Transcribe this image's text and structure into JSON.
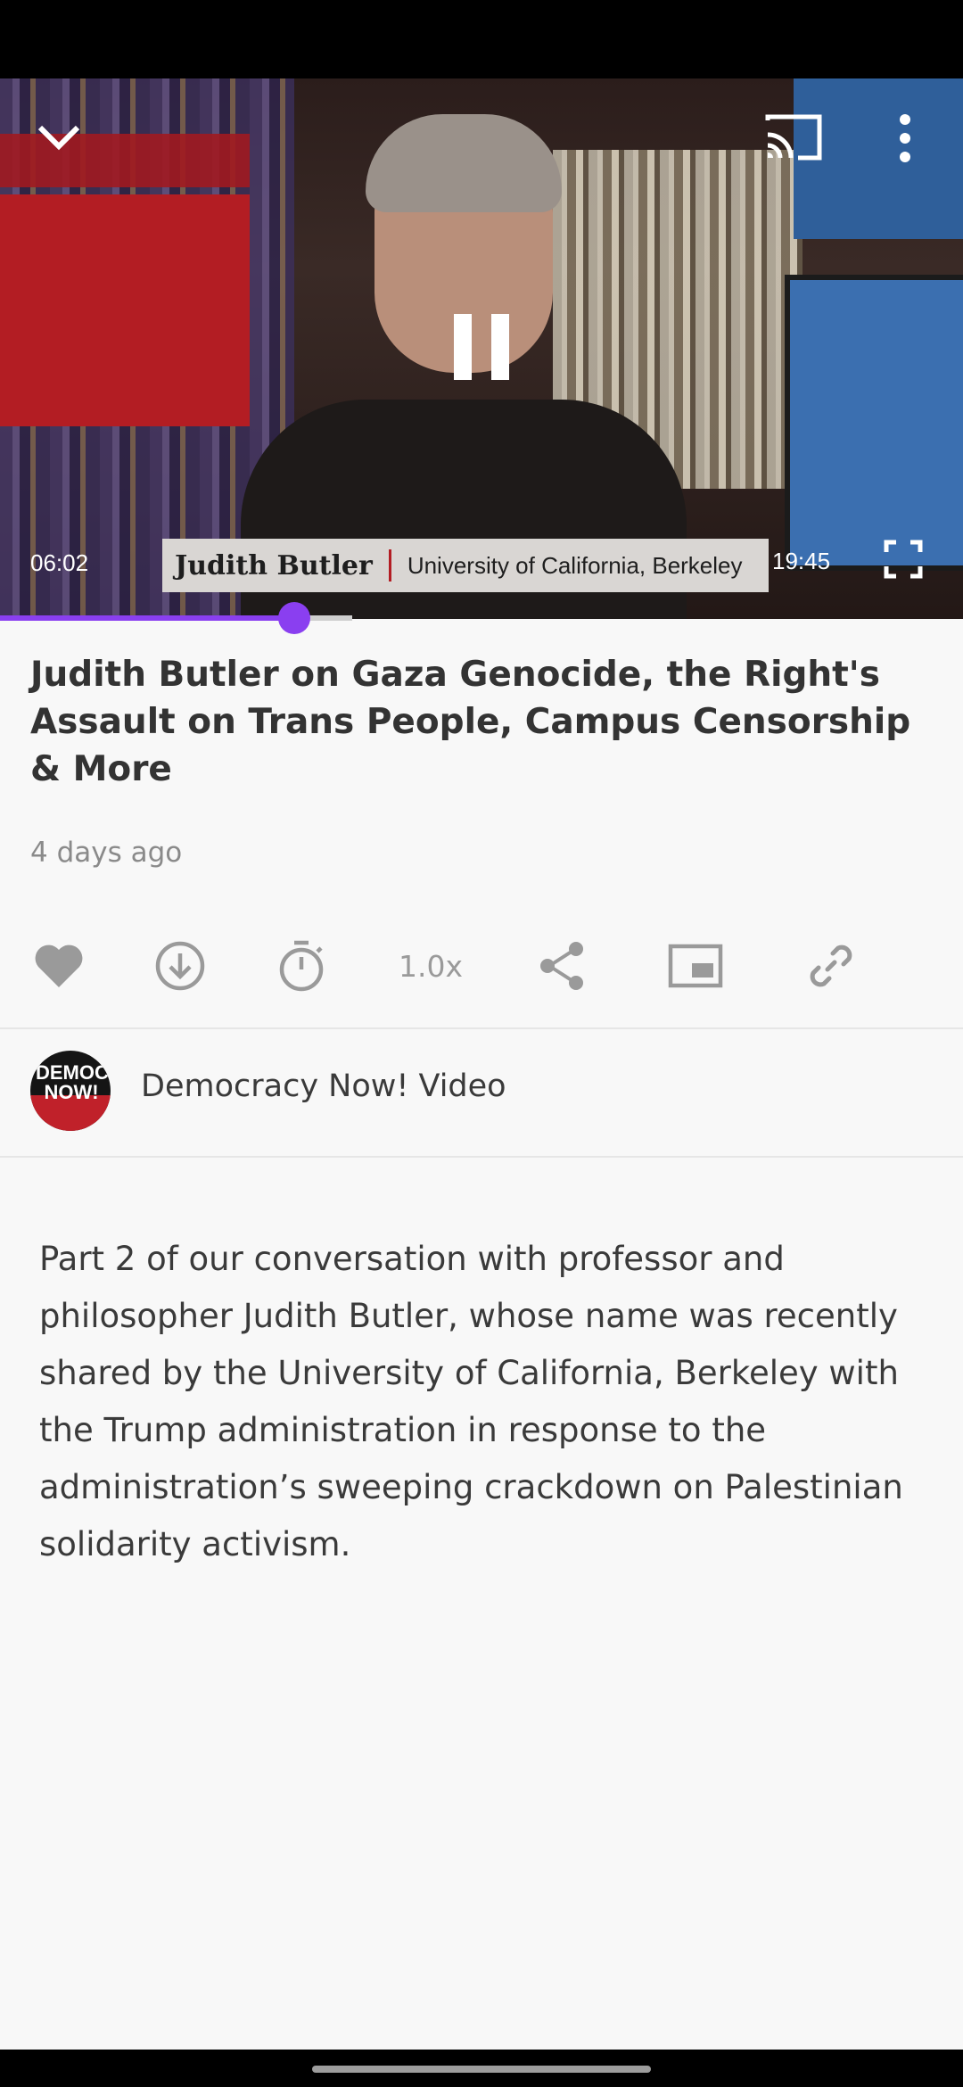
{
  "player": {
    "elapsed": "06:02",
    "duration": "19:45",
    "progress": 0.306,
    "lower_third_name": "Judith Butler",
    "lower_third_affiliation": "University of California, Berkeley",
    "logo_text": "DEMOCRACY NOW!",
    "icons": {
      "collapse": "chevron-down-icon",
      "cast": "cast-icon",
      "more": "more-vert-icon",
      "pause": "pause-icon",
      "fullscreen": "fullscreen-icon"
    },
    "accent_color": "#8a3ff0"
  },
  "video": {
    "title": "Judith Butler on Gaza Genocide, the Right's Assault on Trans People, Campus Censorship & More",
    "posted": "4 days ago"
  },
  "actions": {
    "like_icon": "heart-icon",
    "download_icon": "download-icon",
    "sleep_timer_icon": "timer-icon",
    "speed_label": "1.0x",
    "share_icon": "share-icon",
    "pip_icon": "picture-in-picture-icon",
    "link_icon": "link-icon"
  },
  "channel": {
    "name": "Democracy Now! Video",
    "avatar_text": "DEMOCRACY NOW!"
  },
  "description": "Part 2 of our conversation with professor and philosopher Judith Butler, whose name was recently shared by the University of California, Berkeley with the Trump administration in response to the administration’s sweeping crackdown on Palestinian solidarity activism."
}
